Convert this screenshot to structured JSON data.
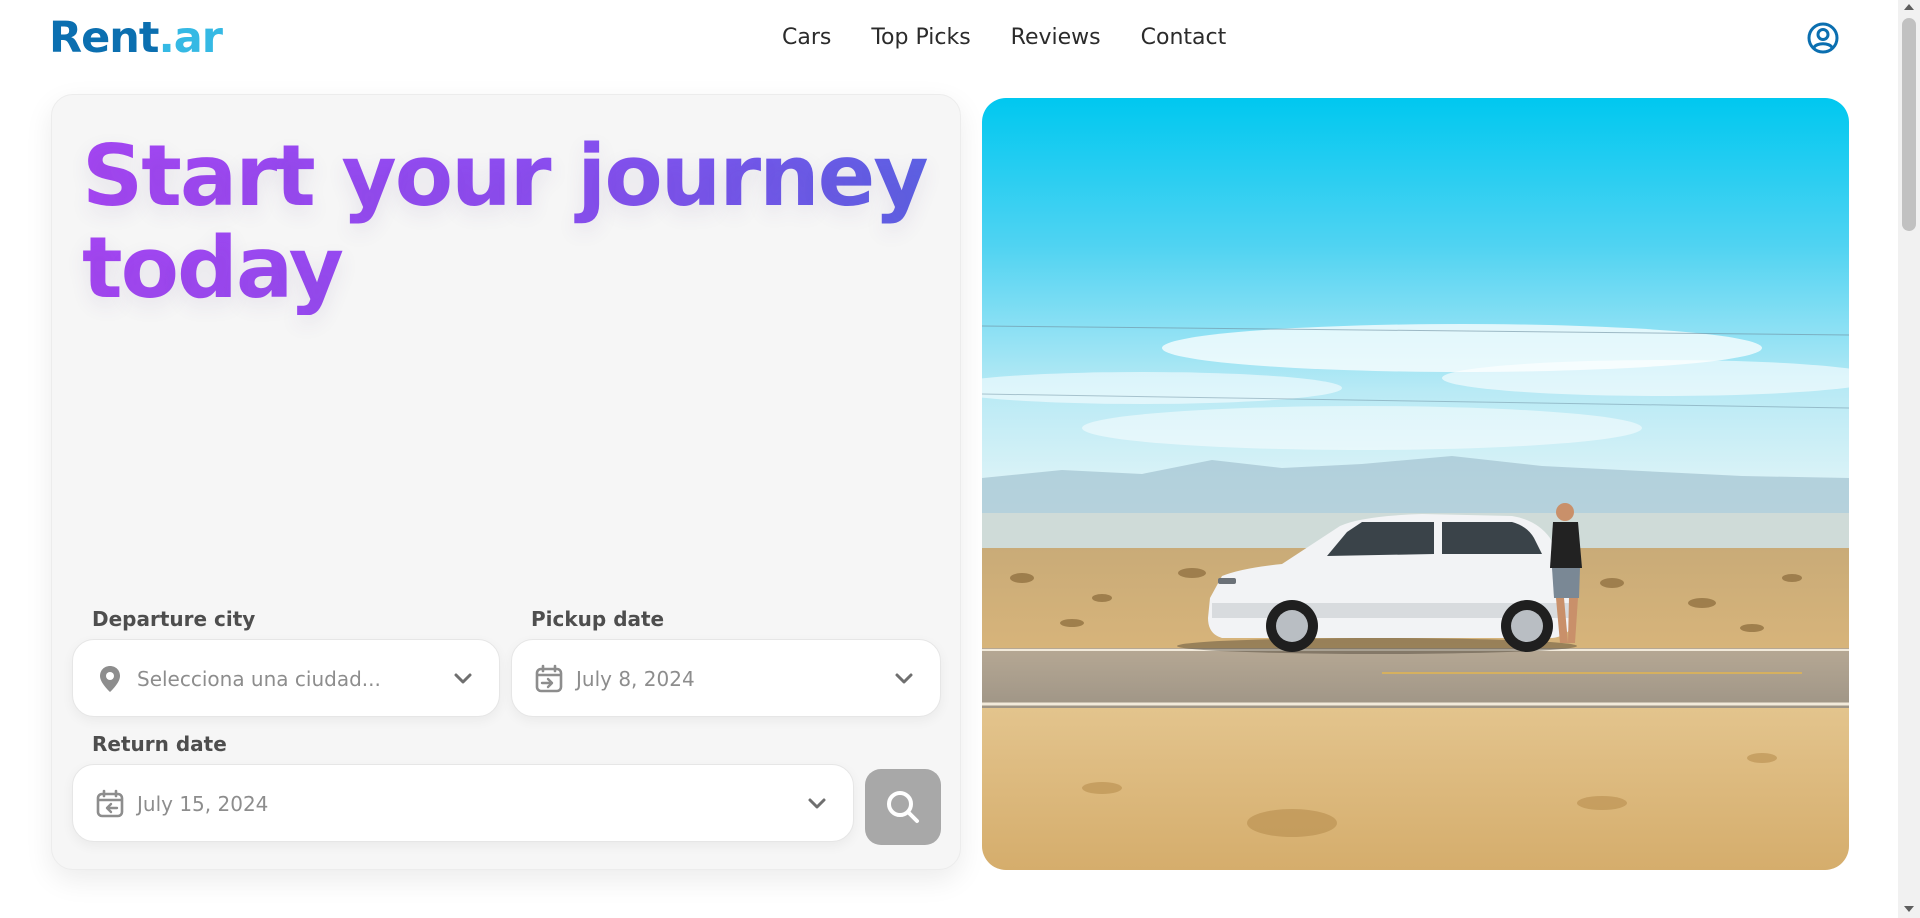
{
  "brand": {
    "logo_part1": "Rent",
    "logo_part2": ".ar",
    "color_primary": "#0b6fb0",
    "color_secondary": "#35b9e4"
  },
  "nav": {
    "items": [
      "Cars",
      "Top Picks",
      "Reviews",
      "Contact"
    ]
  },
  "header": {
    "user_icon": "user-circle-icon"
  },
  "hero": {
    "title": "Start your journey today",
    "gradient": [
      "#a546f3",
      "#5b62e4"
    ],
    "departure": {
      "label": "Departure city",
      "placeholder": "Selecciona una ciudad...",
      "icon": "location-pin-icon"
    },
    "pickup": {
      "label": "Pickup date",
      "value": "July 8, 2024",
      "icon": "calendar-arrow-in-icon"
    },
    "return": {
      "label": "Return date",
      "value": "July 15, 2024",
      "icon": "calendar-arrow-out-icon"
    },
    "search_icon": "search-icon"
  },
  "image": {
    "alt": "White SUV parked on a desert road with a man leaning on it"
  }
}
